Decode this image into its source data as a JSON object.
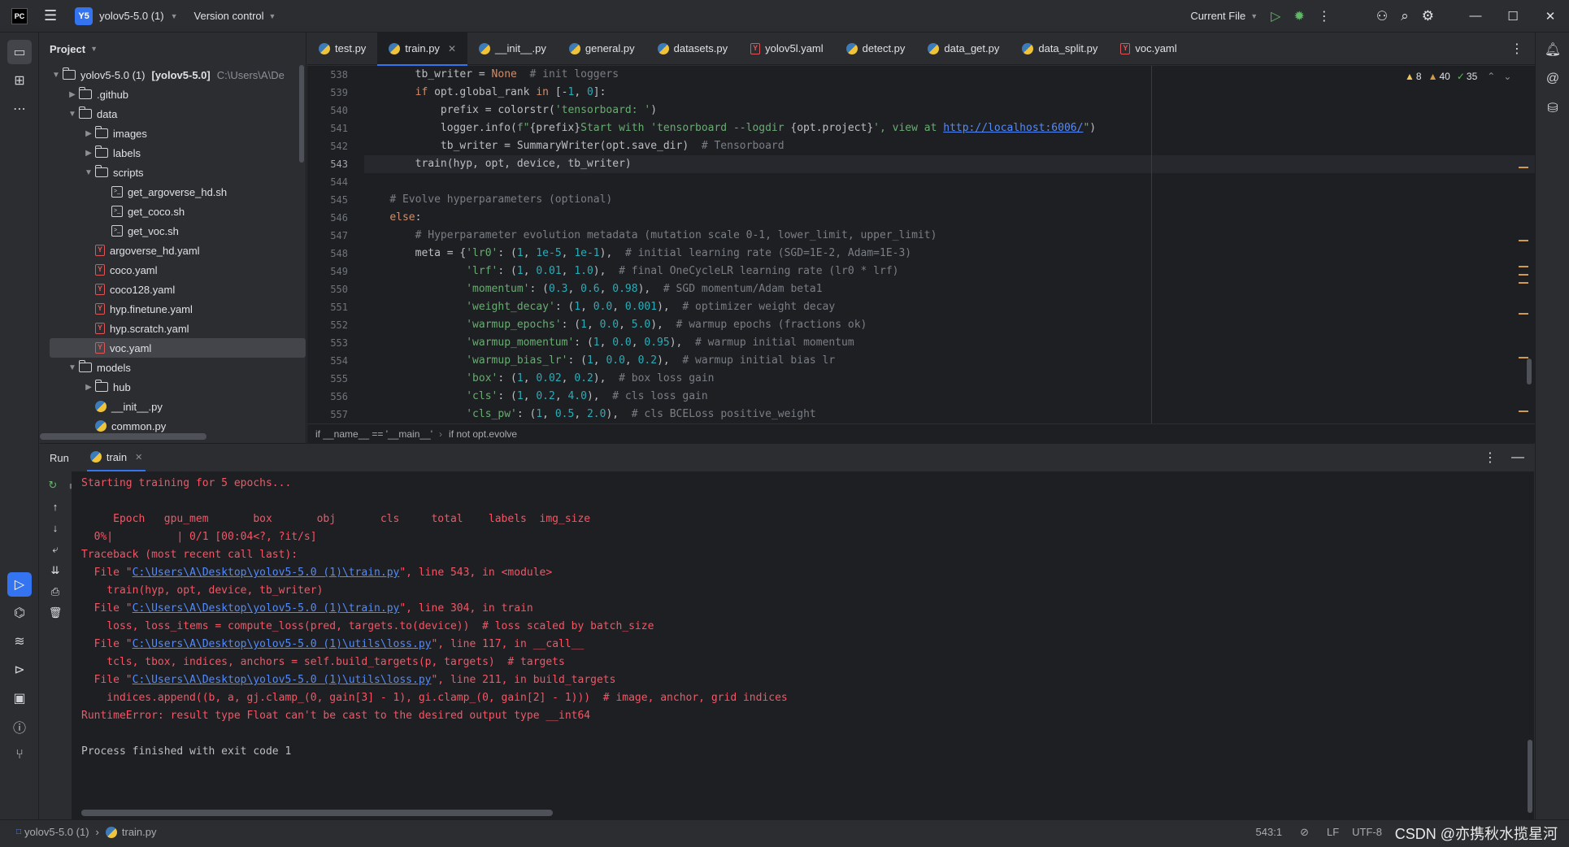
{
  "titlebar": {
    "project_badge": "Y5",
    "project_name": "yolov5-5.0 (1)",
    "vcs_label": "Version control",
    "run_config": "Current File",
    "icons": [
      "app-logo-icon",
      "hamburger-icon",
      "run-icon",
      "debug-icon",
      "more-icon",
      "add-user-icon",
      "search-icon",
      "settings-icon",
      "minimize-icon",
      "maximize-icon",
      "close-icon"
    ]
  },
  "project_panel": {
    "title": "Project",
    "root": {
      "name": "yolov5-5.0 (1)",
      "module": "[yolov5-5.0]",
      "path": "C:\\Users\\A\\De"
    },
    "items": [
      {
        "label": ".github",
        "type": "folder",
        "depth": 1,
        "expand": "collapsed"
      },
      {
        "label": "data",
        "type": "folder",
        "depth": 1,
        "expand": "expanded"
      },
      {
        "label": "images",
        "type": "folder",
        "depth": 2,
        "expand": "collapsed"
      },
      {
        "label": "labels",
        "type": "folder",
        "depth": 2,
        "expand": "collapsed"
      },
      {
        "label": "scripts",
        "type": "folder",
        "depth": 2,
        "expand": "expanded"
      },
      {
        "label": "get_argoverse_hd.sh",
        "type": "sh",
        "depth": 3
      },
      {
        "label": "get_coco.sh",
        "type": "sh",
        "depth": 3
      },
      {
        "label": "get_voc.sh",
        "type": "sh",
        "depth": 3
      },
      {
        "label": "argoverse_hd.yaml",
        "type": "yaml",
        "depth": 2
      },
      {
        "label": "coco.yaml",
        "type": "yaml",
        "depth": 2
      },
      {
        "label": "coco128.yaml",
        "type": "yaml",
        "depth": 2
      },
      {
        "label": "hyp.finetune.yaml",
        "type": "yaml",
        "depth": 2
      },
      {
        "label": "hyp.scratch.yaml",
        "type": "yaml",
        "depth": 2
      },
      {
        "label": "voc.yaml",
        "type": "yaml",
        "depth": 2,
        "selected": true
      },
      {
        "label": "models",
        "type": "folder",
        "depth": 1,
        "expand": "expanded"
      },
      {
        "label": "hub",
        "type": "folder",
        "depth": 2,
        "expand": "collapsed"
      },
      {
        "label": "__init__.py",
        "type": "py",
        "depth": 2
      },
      {
        "label": "common.py",
        "type": "py",
        "depth": 2
      }
    ]
  },
  "tabs": [
    {
      "label": "test.py",
      "icon": "py"
    },
    {
      "label": "train.py",
      "icon": "py",
      "active": true
    },
    {
      "label": "__init__.py",
      "icon": "py"
    },
    {
      "label": "general.py",
      "icon": "py"
    },
    {
      "label": "datasets.py",
      "icon": "py"
    },
    {
      "label": "yolov5l.yaml",
      "icon": "yaml"
    },
    {
      "label": "detect.py",
      "icon": "py"
    },
    {
      "label": "data_get.py",
      "icon": "py"
    },
    {
      "label": "data_split.py",
      "icon": "py"
    },
    {
      "label": "voc.yaml",
      "icon": "yaml"
    }
  ],
  "inspections": {
    "warnings": "8",
    "weak_warnings": "40",
    "typos": "35"
  },
  "editor": {
    "current_line": "543",
    "lines": [
      {
        "n": "538",
        "segs": [
          [
            "        tb_writer = ",
            ""
          ],
          [
            "None",
            "kw"
          ],
          [
            "  # init loggers",
            "cm"
          ]
        ]
      },
      {
        "n": "539",
        "segs": [
          [
            "        ",
            ""
          ],
          [
            "if",
            "kw"
          ],
          [
            " opt.global_rank ",
            ""
          ],
          [
            "in",
            "kw"
          ],
          [
            " [-",
            ""
          ],
          [
            "1",
            "num"
          ],
          [
            ", ",
            ""
          ],
          [
            "0",
            "num"
          ],
          [
            "]:",
            ""
          ]
        ]
      },
      {
        "n": "540",
        "segs": [
          [
            "            prefix = colorstr(",
            ""
          ],
          [
            "'tensorboard: '",
            "str"
          ],
          [
            ")",
            ""
          ]
        ]
      },
      {
        "n": "541",
        "segs": [
          [
            "            logger.info(",
            ""
          ],
          [
            "f\"",
            "str"
          ],
          [
            "{prefix}",
            ""
          ],
          [
            "Start with 'tensorboard --logdir ",
            "str"
          ],
          [
            "{opt.project}",
            ""
          ],
          [
            "', view at ",
            "str"
          ],
          [
            "http://localhost:6006/",
            "lnk"
          ],
          [
            "\"",
            "str"
          ],
          [
            ")",
            ""
          ]
        ]
      },
      {
        "n": "542",
        "segs": [
          [
            "            tb_writer = SummaryWriter(opt.save_dir)  ",
            ""
          ],
          [
            "# Tensorboard",
            "cm"
          ]
        ]
      },
      {
        "n": "543",
        "segs": [
          [
            "        train(hyp, opt, device, tb_writer)",
            ""
          ]
        ]
      },
      {
        "n": "544",
        "segs": [
          [
            "",
            ""
          ]
        ]
      },
      {
        "n": "545",
        "segs": [
          [
            "    ",
            ""
          ],
          [
            "# Evolve hyperparameters (optional)",
            "cm"
          ]
        ]
      },
      {
        "n": "546",
        "segs": [
          [
            "    ",
            ""
          ],
          [
            "else",
            "kw"
          ],
          [
            ":",
            ""
          ]
        ]
      },
      {
        "n": "547",
        "segs": [
          [
            "        ",
            ""
          ],
          [
            "# Hyperparameter evolution metadata (mutation scale 0-1, lower_limit, upper_limit)",
            "cm"
          ]
        ]
      },
      {
        "n": "548",
        "segs": [
          [
            "        meta = {",
            ""
          ],
          [
            "'lr0'",
            "str"
          ],
          [
            ": (",
            ""
          ],
          [
            "1",
            "num"
          ],
          [
            ", ",
            ""
          ],
          [
            "1e-5",
            "num"
          ],
          [
            ", ",
            ""
          ],
          [
            "1e-1",
            "num"
          ],
          [
            "),  ",
            ""
          ],
          [
            "# initial learning rate (SGD=1E-2, Adam=1E-3)",
            "cm"
          ]
        ]
      },
      {
        "n": "549",
        "segs": [
          [
            "                ",
            ""
          ],
          [
            "'lrf'",
            "str"
          ],
          [
            ": (",
            ""
          ],
          [
            "1",
            "num"
          ],
          [
            ", ",
            ""
          ],
          [
            "0.01",
            "num"
          ],
          [
            ", ",
            ""
          ],
          [
            "1.0",
            "num"
          ],
          [
            "),  ",
            ""
          ],
          [
            "# final OneCycleLR learning rate (lr0 * lrf)",
            "cm"
          ]
        ]
      },
      {
        "n": "550",
        "segs": [
          [
            "                ",
            ""
          ],
          [
            "'momentum'",
            "str"
          ],
          [
            ": (",
            ""
          ],
          [
            "0.3",
            "num"
          ],
          [
            ", ",
            ""
          ],
          [
            "0.6",
            "num"
          ],
          [
            ", ",
            ""
          ],
          [
            "0.98",
            "num"
          ],
          [
            "),  ",
            ""
          ],
          [
            "# SGD momentum/Adam beta1",
            "cm"
          ]
        ]
      },
      {
        "n": "551",
        "segs": [
          [
            "                ",
            ""
          ],
          [
            "'weight_decay'",
            "str"
          ],
          [
            ": (",
            ""
          ],
          [
            "1",
            "num"
          ],
          [
            ", ",
            ""
          ],
          [
            "0.0",
            "num"
          ],
          [
            ", ",
            ""
          ],
          [
            "0.001",
            "num"
          ],
          [
            "),  ",
            ""
          ],
          [
            "# optimizer weight decay",
            "cm"
          ]
        ]
      },
      {
        "n": "552",
        "segs": [
          [
            "                ",
            ""
          ],
          [
            "'warmup_epochs'",
            "str"
          ],
          [
            ": (",
            ""
          ],
          [
            "1",
            "num"
          ],
          [
            ", ",
            ""
          ],
          [
            "0.0",
            "num"
          ],
          [
            ", ",
            ""
          ],
          [
            "5.0",
            "num"
          ],
          [
            "),  ",
            ""
          ],
          [
            "# warmup epochs (fractions ok)",
            "cm"
          ]
        ]
      },
      {
        "n": "553",
        "segs": [
          [
            "                ",
            ""
          ],
          [
            "'warmup_momentum'",
            "str"
          ],
          [
            ": (",
            ""
          ],
          [
            "1",
            "num"
          ],
          [
            ", ",
            ""
          ],
          [
            "0.0",
            "num"
          ],
          [
            ", ",
            ""
          ],
          [
            "0.95",
            "num"
          ],
          [
            "),  ",
            ""
          ],
          [
            "# warmup initial momentum",
            "cm"
          ]
        ]
      },
      {
        "n": "554",
        "segs": [
          [
            "                ",
            ""
          ],
          [
            "'warmup_bias_lr'",
            "str"
          ],
          [
            ": (",
            ""
          ],
          [
            "1",
            "num"
          ],
          [
            ", ",
            ""
          ],
          [
            "0.0",
            "num"
          ],
          [
            ", ",
            ""
          ],
          [
            "0.2",
            "num"
          ],
          [
            "),  ",
            ""
          ],
          [
            "# warmup initial bias lr",
            "cm"
          ]
        ]
      },
      {
        "n": "555",
        "segs": [
          [
            "                ",
            ""
          ],
          [
            "'box'",
            "str"
          ],
          [
            ": (",
            ""
          ],
          [
            "1",
            "num"
          ],
          [
            ", ",
            ""
          ],
          [
            "0.02",
            "num"
          ],
          [
            ", ",
            ""
          ],
          [
            "0.2",
            "num"
          ],
          [
            "),  ",
            ""
          ],
          [
            "# box loss gain",
            "cm"
          ]
        ]
      },
      {
        "n": "556",
        "segs": [
          [
            "                ",
            ""
          ],
          [
            "'cls'",
            "str"
          ],
          [
            ": (",
            ""
          ],
          [
            "1",
            "num"
          ],
          [
            ", ",
            ""
          ],
          [
            "0.2",
            "num"
          ],
          [
            ", ",
            ""
          ],
          [
            "4.0",
            "num"
          ],
          [
            "),  ",
            ""
          ],
          [
            "# cls loss gain",
            "cm"
          ]
        ]
      },
      {
        "n": "557",
        "segs": [
          [
            "                ",
            ""
          ],
          [
            "'cls_pw'",
            "str"
          ],
          [
            ": (",
            ""
          ],
          [
            "1",
            "num"
          ],
          [
            ", ",
            ""
          ],
          [
            "0.5",
            "num"
          ],
          [
            ", ",
            ""
          ],
          [
            "2.0",
            "num"
          ],
          [
            "),  ",
            ""
          ],
          [
            "# cls BCELoss positive_weight",
            "cm"
          ]
        ]
      }
    ]
  },
  "breadcrumb": [
    "if __name__ == '__main__'",
    "if not opt.evolve"
  ],
  "run_panel": {
    "title": "Run",
    "tab_label": "train",
    "console": [
      {
        "segs": [
          [
            "Starting training for 5 epochs...",
            ""
          ]
        ]
      },
      {
        "segs": [
          [
            "",
            ""
          ]
        ]
      },
      {
        "segs": [
          [
            "     Epoch   gpu_mem       box       obj       cls     total    labels  img_size",
            ""
          ]
        ]
      },
      {
        "segs": [
          [
            "  0%|          | 0/1 [00:04<?, ?it/s]",
            ""
          ]
        ]
      },
      {
        "segs": [
          [
            "Traceback (most recent call last):",
            ""
          ]
        ]
      },
      {
        "segs": [
          [
            "  File \"",
            ""
          ],
          [
            "C:\\Users\\A\\Desktop\\yolov5-5.0 (1)\\train.py",
            "link"
          ],
          [
            "\", line 543, in <module>",
            ""
          ]
        ]
      },
      {
        "segs": [
          [
            "    train(hyp, opt, device, tb_writer)",
            ""
          ]
        ]
      },
      {
        "segs": [
          [
            "  File \"",
            ""
          ],
          [
            "C:\\Users\\A\\Desktop\\yolov5-5.0 (1)\\train.py",
            "link"
          ],
          [
            "\", line 304, in train",
            ""
          ]
        ]
      },
      {
        "segs": [
          [
            "    loss, loss_items = compute_loss(pred, targets.to(device))  # loss scaled by batch_size",
            ""
          ]
        ]
      },
      {
        "segs": [
          [
            "  File \"",
            ""
          ],
          [
            "C:\\Users\\A\\Desktop\\yolov5-5.0 (1)\\utils\\loss.py",
            "link"
          ],
          [
            "\", line 117, in __call__",
            ""
          ]
        ]
      },
      {
        "segs": [
          [
            "    tcls, tbox, indices, anchors = self.build_targets(p, targets)  # targets",
            ""
          ]
        ]
      },
      {
        "segs": [
          [
            "  File \"",
            ""
          ],
          [
            "C:\\Users\\A\\Desktop\\yolov5-5.0 (1)\\utils\\loss.py",
            "link"
          ],
          [
            "\", line 211, in build_targets",
            ""
          ]
        ]
      },
      {
        "segs": [
          [
            "    indices.append((b, a, gj.clamp_(0, gain[3] - 1), gi.clamp_(0, gain[2] - 1)))  # image, anchor, grid indices",
            ""
          ]
        ]
      },
      {
        "segs": [
          [
            "RuntimeError: result type Float can't be cast to the desired output type __int64",
            ""
          ]
        ]
      },
      {
        "segs": [
          [
            "",
            ""
          ]
        ]
      },
      {
        "segs": [
          [
            "Process finished with exit code 1",
            "plain"
          ]
        ]
      }
    ]
  },
  "status_bar": {
    "project": "yolov5-5.0 (1)",
    "file": "train.py",
    "position": "543:1",
    "line_sep": "LF",
    "encoding": "UTF-8"
  },
  "watermark": "CSDN @亦携秋水揽星河"
}
